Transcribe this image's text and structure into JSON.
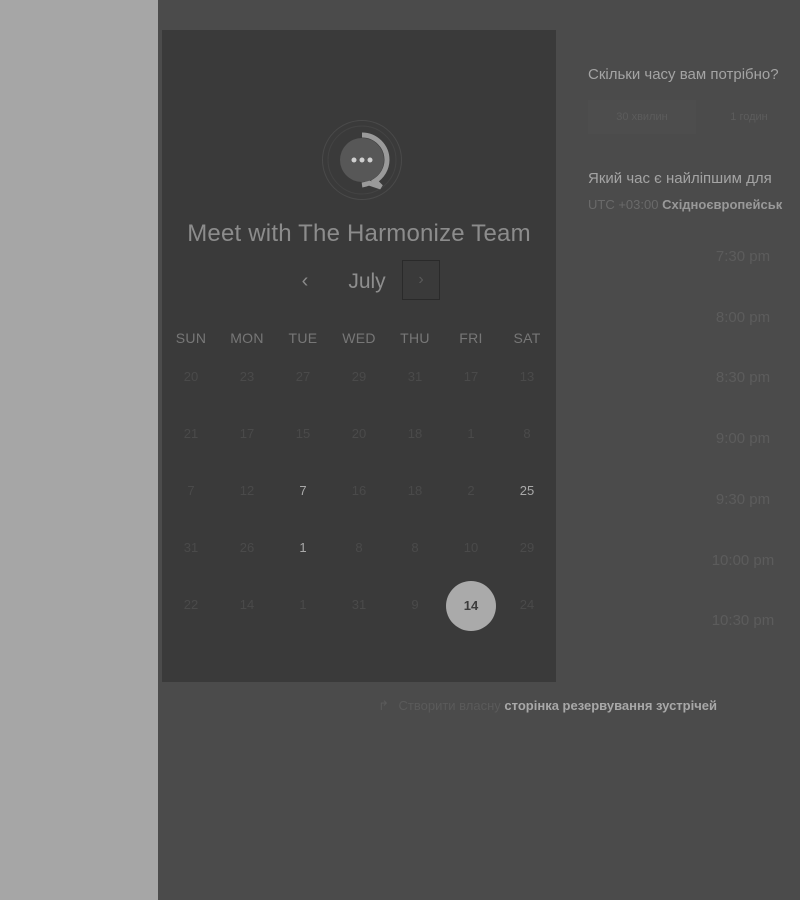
{
  "booking_card": {
    "title": "Meet with The Harmonize Team",
    "logo_icon": "chat-bubble-logo-icon",
    "month": "July",
    "prev_icon": "‹",
    "next_icon": "›",
    "weekdays": [
      "SUN",
      "MON",
      "TUE",
      "WED",
      "THU",
      "FRI",
      "SAT"
    ],
    "weeks": [
      [
        {
          "d": "20"
        },
        {
          "d": "23"
        },
        {
          "d": "27"
        },
        {
          "d": "29"
        },
        {
          "d": "31"
        },
        {
          "d": "17"
        },
        {
          "d": "13"
        }
      ],
      [
        {
          "d": "21"
        },
        {
          "d": "17"
        },
        {
          "d": "15"
        },
        {
          "d": "20"
        },
        {
          "d": "18"
        },
        {
          "d": "1"
        },
        {
          "d": "8"
        }
      ],
      [
        {
          "d": "7"
        },
        {
          "d": "12"
        },
        {
          "d": "7",
          "avail": true
        },
        {
          "d": "16"
        },
        {
          "d": "18"
        },
        {
          "d": "2"
        },
        {
          "d": "25",
          "avail": true
        }
      ],
      [
        {
          "d": "31"
        },
        {
          "d": "26"
        },
        {
          "d": "1",
          "avail": true
        },
        {
          "d": "8"
        },
        {
          "d": "8"
        },
        {
          "d": "10"
        },
        {
          "d": "29"
        }
      ],
      [
        {
          "d": "22"
        },
        {
          "d": "14"
        },
        {
          "d": "1"
        },
        {
          "d": "31"
        },
        {
          "d": "9"
        },
        {
          "d": "14",
          "selected": true
        },
        {
          "d": "24"
        }
      ]
    ]
  },
  "duration": {
    "heading": "Скільки часу вам потрібно?",
    "options": [
      "30 хвилин",
      "1 годин"
    ]
  },
  "time": {
    "heading": "Який час є найліпшим для",
    "tz_offset": "UTC +03:00",
    "tz_name": "Східноєвропейськ",
    "slots": [
      "7:30 pm",
      "8:00 pm",
      "8:30 pm",
      "9:00 pm",
      "9:30 pm",
      "10:00 pm",
      "10:30 pm"
    ]
  },
  "footer": {
    "icon": "↱",
    "text": "Створити власну",
    "link": "сторінка резервування зустрічей"
  },
  "colors": {
    "page_bg": "#a6a6a6",
    "panel_bg": "#4b4b4b",
    "card_bg": "#3a3a3a",
    "selected_day": "#aaaaaa"
  }
}
